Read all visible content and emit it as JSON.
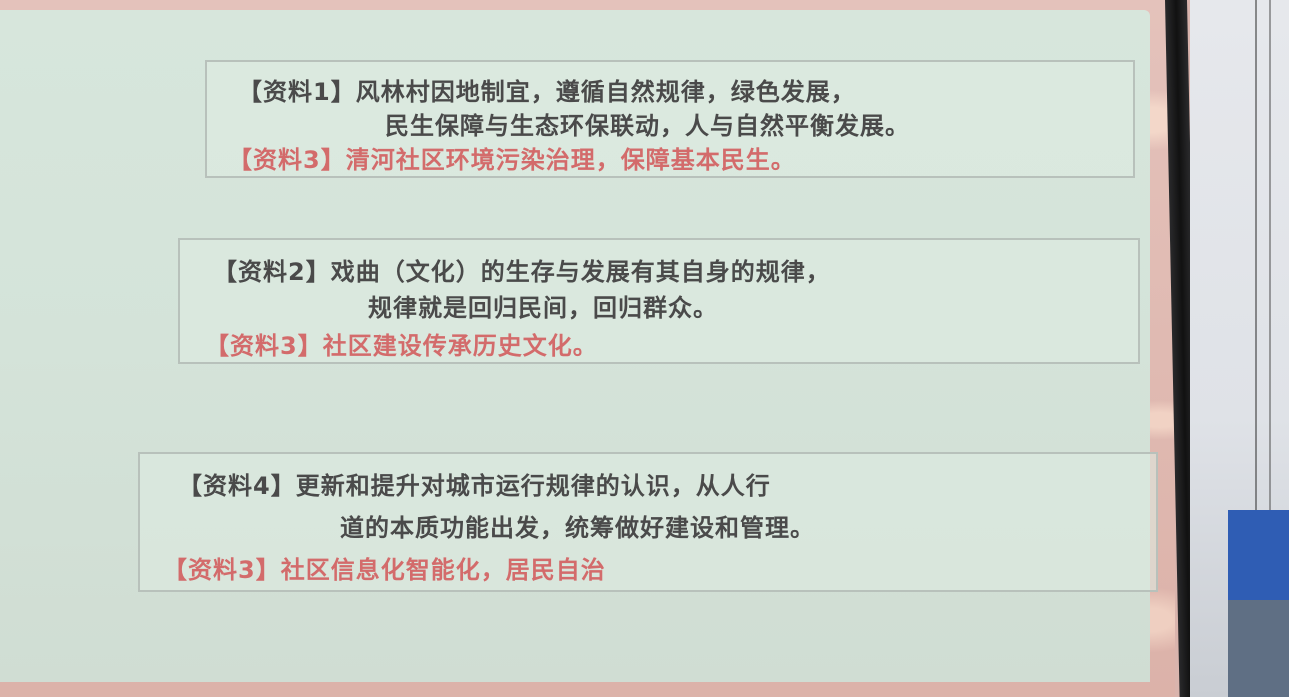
{
  "cards": [
    {
      "line1_label": "【资料1】",
      "line1_text": "风林村因地制宜，遵循自然规律，绿色发展，",
      "line2_text": "民生保障与生态环保联动，人与自然平衡发展。",
      "line3_label": "【资料3】",
      "line3_text": "清河社区环境污染治理，保障基本民生。"
    },
    {
      "line1_label": "【资料2】",
      "line1_text": "戏曲（文化）的生存与发展有其自身的规律，",
      "line2_text": "规律就是回归民间，回归群众。",
      "line3_label": "【资料3】",
      "line3_text": "社区建设传承历史文化。"
    },
    {
      "line1_label": "【资料4】",
      "line1_text": "更新和提升对城市运行规律的认识，从人行",
      "line2_text": "道的本质功能出发，统筹做好建设和管理。",
      "line3_label": "【资料3】",
      "line3_text": "社区信息化智能化，居民自治"
    }
  ],
  "colors": {
    "body_text": "#4a4a4a",
    "highlight_red": "#d36b6b",
    "slide_bg": "#d7e6dc",
    "frame_pink": "#dcb2a9"
  }
}
